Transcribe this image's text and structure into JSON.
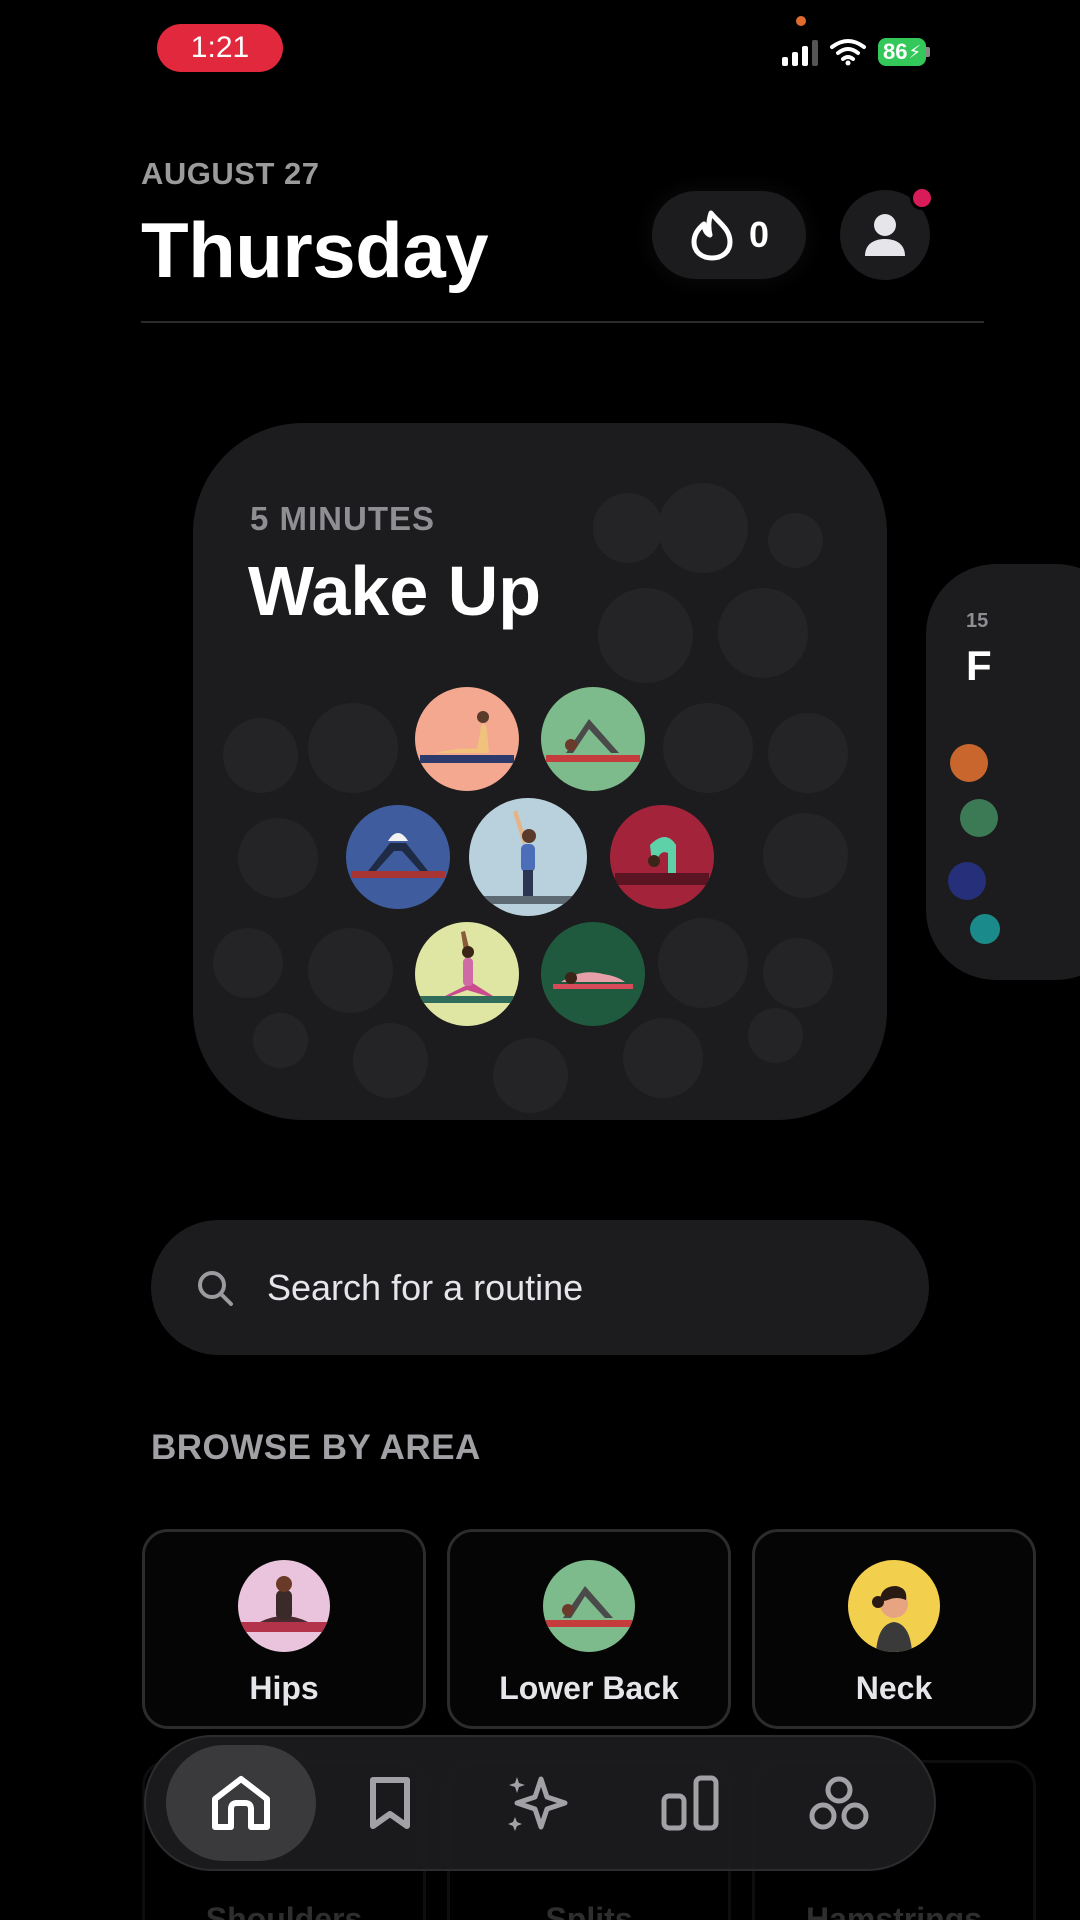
{
  "status": {
    "time": "1:21",
    "battery": "86"
  },
  "header": {
    "date": "AUGUST 27",
    "day": "Thursday",
    "streak_count": "0"
  },
  "featured": {
    "duration": "5 MINUTES",
    "title": "Wake Up"
  },
  "next_card": {
    "duration": "15",
    "title": "F"
  },
  "search": {
    "placeholder": "Search for a routine"
  },
  "browse": {
    "label": "BROWSE BY AREA",
    "areas": [
      {
        "label": "Hips"
      },
      {
        "label": "Lower Back"
      },
      {
        "label": "Neck"
      }
    ],
    "areas_row2": [
      {
        "label": "Shoulders"
      },
      {
        "label": "Splits"
      },
      {
        "label": "Hamstrings"
      }
    ]
  },
  "tabbar": {
    "tabs": [
      {
        "icon": "home-icon",
        "active": true
      },
      {
        "icon": "bookmark-icon",
        "active": false
      },
      {
        "icon": "sparkle-icon",
        "active": false
      },
      {
        "icon": "stats-icon",
        "active": false
      },
      {
        "icon": "community-icon",
        "active": false
      }
    ]
  },
  "colors": {
    "background": "#000000",
    "surface": "#1c1c1e",
    "status_time_bg": "#e1283c",
    "battery": "#34c759",
    "notification_dot": "#d81c5a"
  }
}
